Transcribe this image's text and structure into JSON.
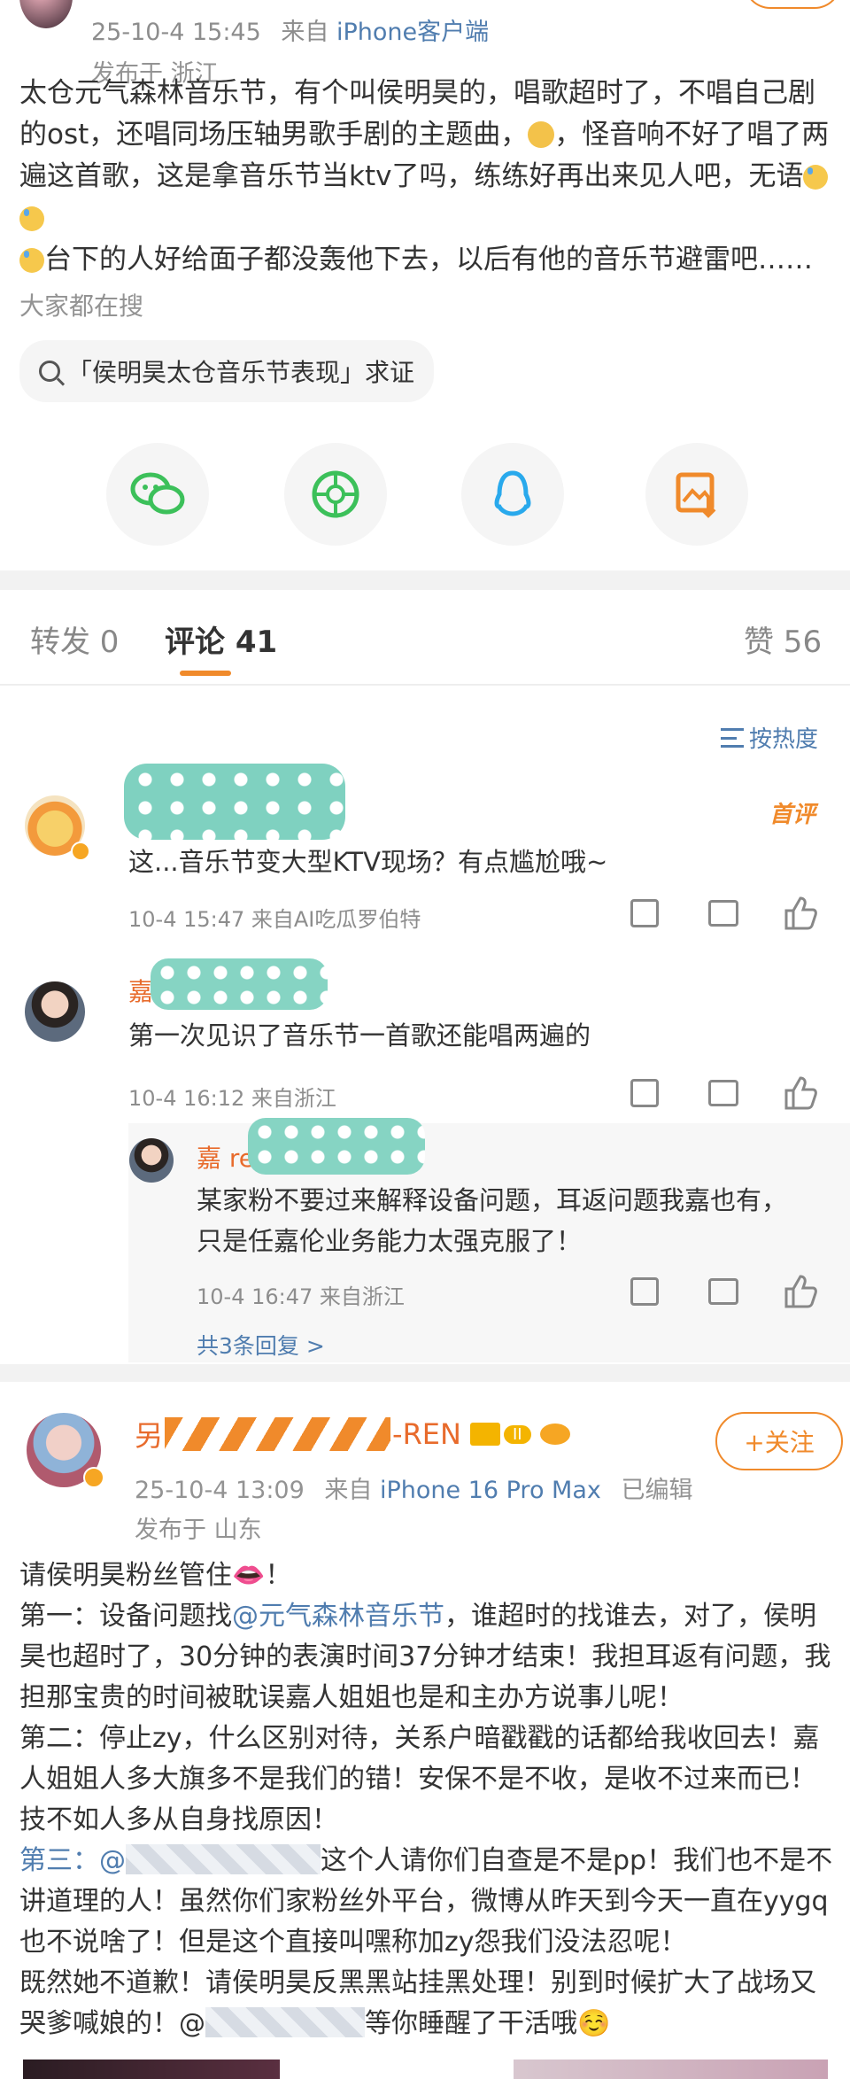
{
  "post": {
    "timestamp": "25-10-4 15:45",
    "source_prefix": "来自",
    "source": "iPhone客户端",
    "location": "发布于 浙江",
    "text": "太仓元气森林音乐节，有个叫侯明昊的，唱歌超时了，不唱自己剧的ost，还唱同场压轴男歌手剧的主题曲，",
    "text2": "，怪音响不好了唱了两遍这首歌，这是拿音乐节当ktv了吗，练练好再出来见人吧，无语",
    "text3": "台下的人好给面子都没轰他下去，以后有他的音乐节避雷吧……",
    "search_label": "大家都在搜",
    "search_pill": "「侯明昊太仓音乐节表现」求证"
  },
  "share_icons": [
    "wechat-icon",
    "moments-icon",
    "qq-icon",
    "save-image-icon"
  ],
  "tabs": {
    "repost": "转发 0",
    "comments": "评论 41",
    "likes": "赞 56"
  },
  "sort": {
    "label": "按热度"
  },
  "comments": [
    {
      "badge": "首评",
      "text": "这...音乐节变大型KTV现场？有点尴尬哦~",
      "meta": "10-4 15:47  来自AI吃瓜罗伯特"
    },
    {
      "name_prefix": "嘉",
      "text": "第一次见识了音乐节一首歌还能唱两遍的",
      "meta": "10-4 16:12  来自浙江"
    }
  ],
  "reply": {
    "name_prefix": "嘉 re",
    "text_line1": "某家粉不要过来解释设备问题，耳返问题我嘉也有，",
    "text_line2": "只是任嘉伦业务能力太强克服了！",
    "meta": "10-4 16:47  来自浙江",
    "more": "共3条回复 >"
  },
  "repost_post": {
    "name_prefix": "另",
    "name_suffix": "-REN",
    "level": "II",
    "follow": "+关注",
    "timestamp": "25-10-4 13:09",
    "source_prefix": "来自",
    "source": "iPhone 16 Pro Max",
    "edited": "已编辑",
    "location": "发布于 山东",
    "lines": [
      "请侯明昊粉丝管住👄！",
      "第一：设备问题找",
      "@元气森林音乐节",
      "，谁超时的找谁去，对了，侯明昊也超时了，30分钟的表演时间37分钟才结束！我担耳返有问题，我担那宝贵的时间被耽误嘉人姐姐也是和主办方说事儿呢！",
      "第二：停止zy，什么区别对待，关系户暗戳戳的话都给我收回去！嘉人姐姐人多大旗多不是我们的错！安保不是不收，是收不过来而已！技不如人多从自身找原因！",
      "第三：@",
      "这个人请你们自查是不是pp！我们也不是不讲道理的人！虽然你们家粉丝外平台，微博从昨天到今天一直在yygq也不说啥了！但是这个直接叫嘿称加zy怨我们没法忍呢！",
      "既然她不道歉！请侯明昊反黑黑站挂黑处理！别到时候扩大了战场又哭爹喊娘的！@",
      "等你睡醒了干活哦☺️"
    ]
  }
}
